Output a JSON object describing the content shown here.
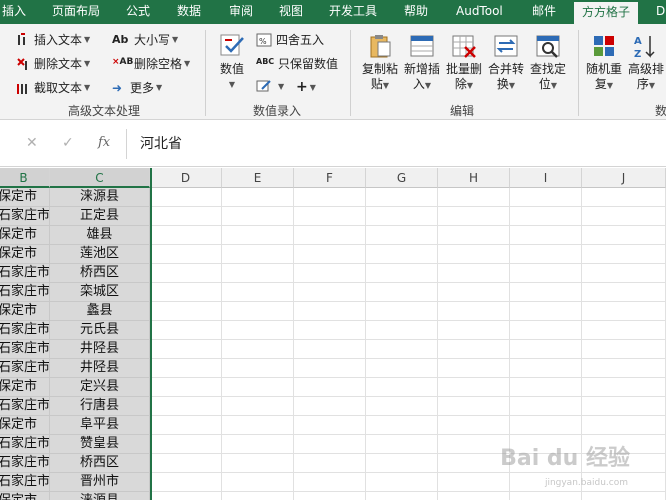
{
  "tabs": [
    {
      "label": "插入",
      "active": false
    },
    {
      "label": "页面布局",
      "active": false
    },
    {
      "label": "公式",
      "active": false
    },
    {
      "label": "数据",
      "active": false
    },
    {
      "label": "审阅",
      "active": false
    },
    {
      "label": "视图",
      "active": false
    },
    {
      "label": "开发工具",
      "active": false
    },
    {
      "label": "帮助",
      "active": false
    },
    {
      "label": "AudTool",
      "active": false
    },
    {
      "label": "邮件",
      "active": false
    },
    {
      "label": "方方格子",
      "active": true
    },
    {
      "label": "D",
      "active": false
    }
  ],
  "ribbon": {
    "text_group": {
      "insert_text": "插入文本",
      "delete_text": "删除文本",
      "extract_text": "截取文本",
      "case": "大小写",
      "delete_space": "删除空格",
      "more": "更多",
      "label": "高级文本处理"
    },
    "number_group": {
      "value": "数值",
      "round": "四舍五入",
      "keep_value": "只保留数值",
      "label": "数值录入"
    },
    "edit_group": {
      "copy_paste": [
        "复制粘",
        "贴"
      ],
      "insert_new": [
        "新增插",
        "入"
      ],
      "batch_delete": [
        "批量删",
        "除"
      ],
      "merge_convert": [
        "合并转",
        "换"
      ],
      "find_locate": [
        "查找定",
        "位"
      ],
      "label": "编辑"
    },
    "sort_group": {
      "random_reorder": [
        "随机重",
        "复"
      ],
      "advanced_sort": [
        "高级排",
        "序"
      ],
      "label": "数"
    }
  },
  "formula_bar": {
    "cancel": "✕",
    "confirm": "✓",
    "fx": "fx",
    "value": "河北省"
  },
  "columns": [
    "B",
    "C",
    "D",
    "E",
    "F",
    "G",
    "H",
    "I",
    "J"
  ],
  "rows": [
    [
      "保定市",
      "涞源县"
    ],
    [
      "石家庄市",
      "正定县"
    ],
    [
      "保定市",
      "雄县"
    ],
    [
      "保定市",
      "莲池区"
    ],
    [
      "石家庄市",
      "桥西区"
    ],
    [
      "石家庄市",
      "栾城区"
    ],
    [
      "保定市",
      "蠡县"
    ],
    [
      "石家庄市",
      "元氏县"
    ],
    [
      "石家庄市",
      "井陉县"
    ],
    [
      "石家庄市",
      "井陉县"
    ],
    [
      "保定市",
      "定兴县"
    ],
    [
      "石家庄市",
      "行唐县"
    ],
    [
      "保定市",
      "阜平县"
    ],
    [
      "石家庄市",
      "赞皇县"
    ],
    [
      "石家庄市",
      "桥西区"
    ],
    [
      "石家庄市",
      "晋州市"
    ],
    [
      "保定市",
      "涞源县"
    ]
  ],
  "watermark": {
    "text": "Bai du 经验",
    "sub": "jingyan.baidu.com"
  }
}
